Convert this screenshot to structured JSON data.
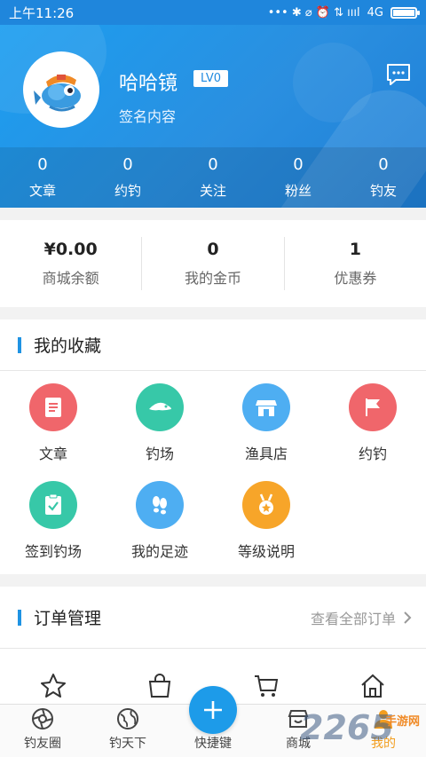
{
  "status_bar": {
    "time": "上午11:26",
    "network": "4G",
    "signal_icons": "••• ✱ ⌀ ⏰ ⇅ ıııl"
  },
  "profile": {
    "username": "哈哈镜",
    "level": "LV0",
    "signature": "签名内容",
    "stats": [
      {
        "value": "0",
        "label": "文章"
      },
      {
        "value": "0",
        "label": "约钓"
      },
      {
        "value": "0",
        "label": "关注"
      },
      {
        "value": "0",
        "label": "粉丝"
      },
      {
        "value": "0",
        "label": "钓友"
      }
    ]
  },
  "wallet": [
    {
      "value": "¥0.00",
      "label": "商城余额"
    },
    {
      "value": "0",
      "label": "我的金币"
    },
    {
      "value": "1",
      "label": "优惠券"
    }
  ],
  "favorites": {
    "title": "我的收藏",
    "items": [
      {
        "label": "文章",
        "icon": "document-icon",
        "color": "#f0666b"
      },
      {
        "label": "钓场",
        "icon": "fish-icon",
        "color": "#37c8a8"
      },
      {
        "label": "渔具店",
        "icon": "shop-icon",
        "color": "#4eaef2"
      },
      {
        "label": "约钓",
        "icon": "flag-icon",
        "color": "#f0666b"
      },
      {
        "label": "签到钓场",
        "icon": "checkin-icon",
        "color": "#37c8a8"
      },
      {
        "label": "我的足迹",
        "icon": "footprint-icon",
        "color": "#4eaef2"
      },
      {
        "label": "等级说明",
        "icon": "medal-icon",
        "color": "#f7a529"
      }
    ]
  },
  "orders": {
    "title": "订单管理",
    "view_all": "查看全部订单",
    "icons": [
      "star-icon",
      "bag-icon",
      "cart-icon",
      "home-icon"
    ]
  },
  "tabbar": {
    "tabs": [
      {
        "label": "钓友圈",
        "icon": "aperture-icon"
      },
      {
        "label": "钓天下",
        "icon": "globe-icon"
      },
      {
        "label": "快捷键",
        "icon": "plus-icon"
      },
      {
        "label": "商城",
        "icon": "store-icon"
      },
      {
        "label": "我的",
        "icon": "person-icon",
        "active": true
      }
    ]
  },
  "watermark": {
    "text": "2265",
    "sub": "手游网"
  },
  "colors": {
    "primary": "#1f8ae0",
    "active_tab": "#f29d1e"
  }
}
